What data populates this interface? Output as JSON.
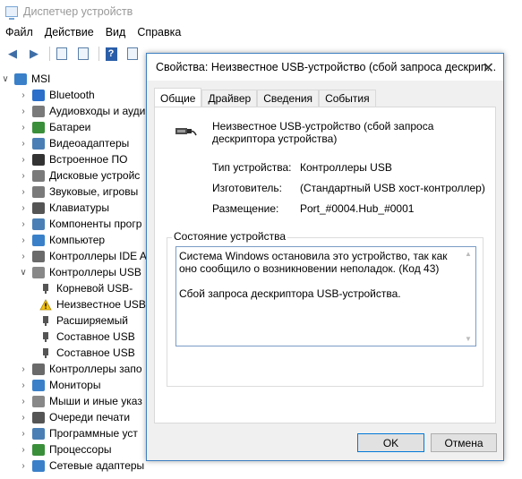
{
  "window": {
    "title": "Диспетчер устройств"
  },
  "menu": [
    "Файл",
    "Действие",
    "Вид",
    "Справка"
  ],
  "tree": {
    "root": "MSI",
    "items": [
      {
        "label": "Bluetooth",
        "expanded": false
      },
      {
        "label": "Аудиовходы и ауди",
        "expanded": false
      },
      {
        "label": "Батареи",
        "expanded": false
      },
      {
        "label": "Видеоадаптеры",
        "expanded": false
      },
      {
        "label": "Встроенное ПО",
        "expanded": false
      },
      {
        "label": "Дисковые устройс",
        "expanded": false
      },
      {
        "label": "Звуковые, игровы",
        "expanded": false
      },
      {
        "label": "Клавиатуры",
        "expanded": false
      },
      {
        "label": "Компоненты прогр",
        "expanded": false
      },
      {
        "label": "Компьютер",
        "expanded": false
      },
      {
        "label": "Контроллеры IDE A",
        "expanded": false
      },
      {
        "label": "Контроллеры USB",
        "expanded": true
      },
      {
        "label": "Корневой USB-",
        "child": true
      },
      {
        "label": "Неизвестное USB",
        "child": true,
        "warning": true
      },
      {
        "label": "Расширяемый",
        "child": true
      },
      {
        "label": "Составное USB",
        "child": true
      },
      {
        "label": "Составное USB",
        "child": true
      },
      {
        "label": "Контроллеры запо",
        "expanded": false
      },
      {
        "label": "Мониторы",
        "expanded": false
      },
      {
        "label": "Мыши и иные указ",
        "expanded": false
      },
      {
        "label": "Очереди печати",
        "expanded": false
      },
      {
        "label": "Программные уст",
        "expanded": false
      },
      {
        "label": "Процессоры",
        "expanded": false
      },
      {
        "label": "Сетевые адаптеры",
        "expanded": false
      }
    ]
  },
  "dialog": {
    "title": "Свойства: Неизвестное USB-устройство (сбой запроса дескрип...",
    "tabs": [
      "Общие",
      "Драйвер",
      "Сведения",
      "События"
    ],
    "device_name": "Неизвестное USB-устройство (сбой запроса дескриптора устройства)",
    "props": {
      "type_label": "Тип устройства:",
      "type_value": "Контроллеры USB",
      "mfr_label": "Изготовитель:",
      "mfr_value": "(Стандартный USB хост-контроллер)",
      "loc_label": "Размещение:",
      "loc_value": "Port_#0004.Hub_#0001"
    },
    "status_legend": "Состояние устройства",
    "status_text": "Система Windows остановила это устройство, так как оно сообщило о возникновении неполадок. (Код 43)\n\nСбой запроса дескриптора USB-устройства.",
    "ok": "OK",
    "cancel": "Отмена"
  },
  "colors": {
    "accent": "#0078d7",
    "dialog_border": "#3c7fc1"
  }
}
